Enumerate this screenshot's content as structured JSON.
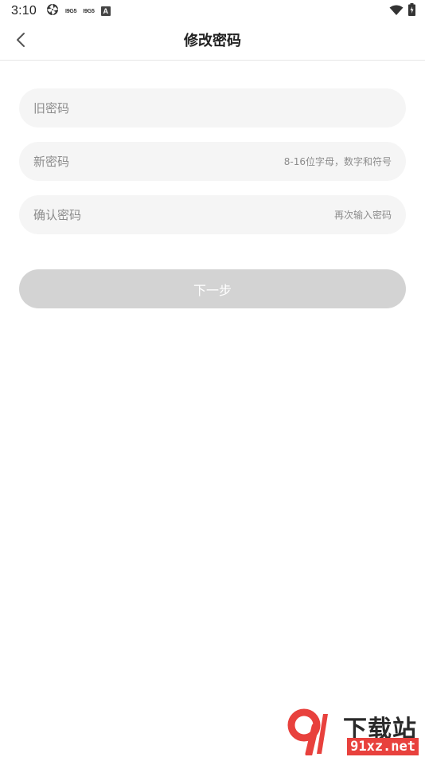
{
  "status_bar": {
    "time": "3:10",
    "badge1": "I9G5",
    "badge2": "I9G5",
    "badge3": "A"
  },
  "header": {
    "title": "修改密码"
  },
  "form": {
    "old_password": {
      "label": "旧密码",
      "hint": ""
    },
    "new_password": {
      "label": "新密码",
      "hint": "8-16位字母，数字和符号"
    },
    "confirm_password": {
      "label": "确认密码",
      "hint": "再次输入密码"
    }
  },
  "actions": {
    "next_label": "下一步"
  },
  "watermark": {
    "top_text": "下载站",
    "bottom_text": "91xz.net"
  },
  "colors": {
    "field_bg": "#f5f5f5",
    "button_disabled_bg": "#d3d3d3",
    "placeholder": "#8c8c8c",
    "watermark_red": "#e8413d"
  }
}
